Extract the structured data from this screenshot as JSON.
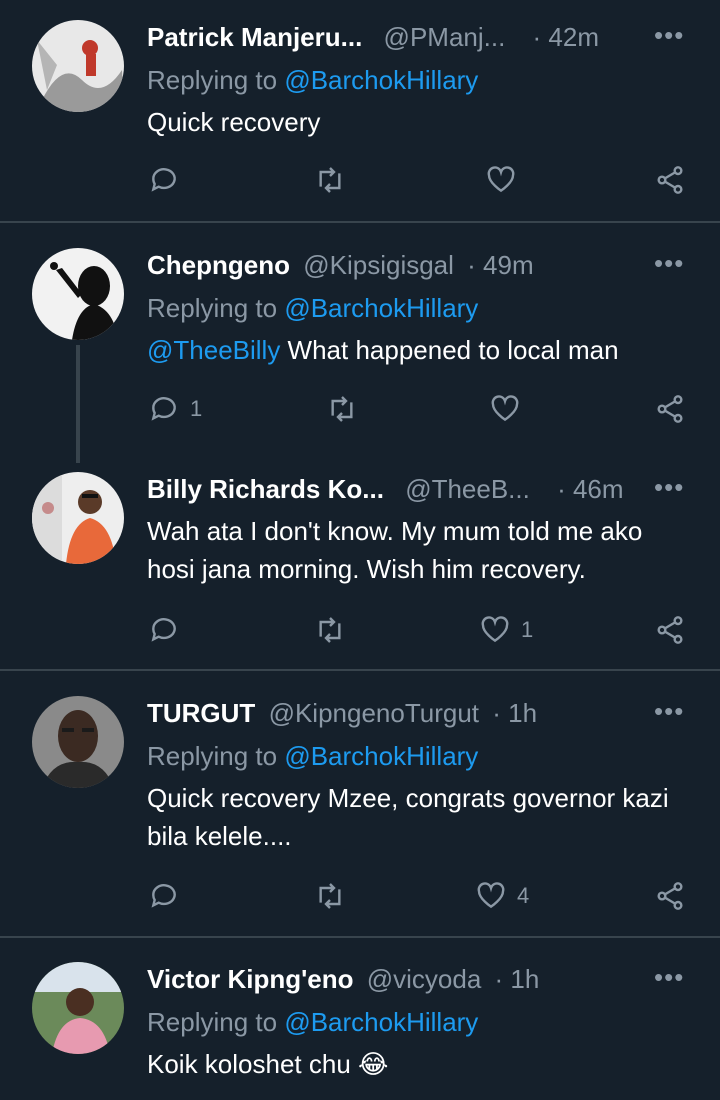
{
  "tweets": [
    {
      "name": "Patrick Manjeru...",
      "handle": "@PManj...",
      "time": "· 42m",
      "replying_prefix": "Replying to",
      "replying_to": "@BarchokHillary",
      "mention": "",
      "text": "Quick recovery",
      "reply_count": "",
      "retweet_count": "",
      "like_count": ""
    },
    {
      "name": "Chepngeno",
      "handle": "@Kipsigisgal",
      "time": "· 49m",
      "replying_prefix": "Replying to",
      "replying_to": "@BarchokHillary",
      "mention": "@TheeBilly",
      "text": " What happened to local man",
      "reply_count": "1",
      "retweet_count": "",
      "like_count": ""
    },
    {
      "name": "Billy Richards Ko...",
      "handle": "@TheeB...",
      "time": "· 46m",
      "replying_prefix": "",
      "replying_to": "",
      "mention": "",
      "text": "Wah ata I don't know. My mum told me ako hosi jana morning. Wish him recovery.",
      "reply_count": "",
      "retweet_count": "",
      "like_count": "1"
    },
    {
      "name": "TURGUT",
      "handle": "@KipngenoTurgut",
      "time": "· 1h",
      "replying_prefix": "Replying to",
      "replying_to": "@BarchokHillary",
      "mention": "",
      "text": "Quick recovery Mzee, congrats governor kazi bila kelele....",
      "reply_count": "",
      "retweet_count": "",
      "like_count": "4"
    },
    {
      "name": "Victor Kipng'eno",
      "handle": "@vicyoda",
      "time": "· 1h",
      "replying_prefix": "Replying to",
      "replying_to": "@BarchokHillary",
      "mention": "",
      "text": "Koik koloshet chu 😂",
      "reply_count": "",
      "retweet_count": "",
      "like_count": ""
    }
  ],
  "more_glyph": "•••",
  "colors": {
    "background": "#15202b",
    "muted": "#8b98a5",
    "link": "#1d9bf0",
    "divider": "#38444d"
  },
  "icons": [
    "reply-icon",
    "retweet-icon",
    "like-icon",
    "share-icon",
    "more-icon"
  ]
}
